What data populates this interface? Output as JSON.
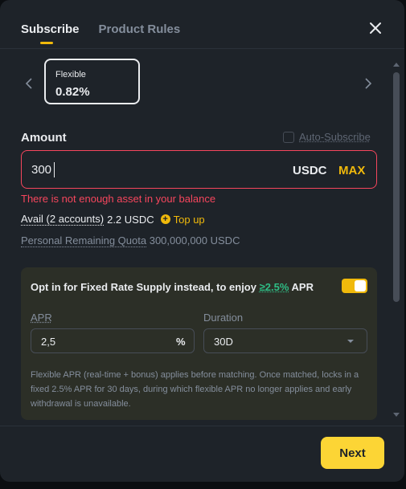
{
  "tabs": [
    {
      "label": "Subscribe",
      "active": true
    },
    {
      "label": "Product Rules",
      "active": false
    }
  ],
  "icons": {
    "close": "close-icon",
    "prev": "chevron-left-icon",
    "next": "chevron-right-icon",
    "topup": "plus-circle-icon",
    "dropdown": "chevron-down-icon"
  },
  "product": {
    "name": "Flexible",
    "rate": "0.82%"
  },
  "amount": {
    "label": "Amount",
    "auto_subscribe_label": "Auto-Subscribe",
    "auto_subscribe_checked": false,
    "value": "300",
    "unit": "USDC",
    "max_label": "MAX",
    "error": "There is not enough asset in your balance"
  },
  "avail": {
    "accounts_label": "Avail (2 accounts)",
    "value": "2.2 USDC",
    "topup_label": "Top up"
  },
  "quota": {
    "label": "Personal Remaining Quota",
    "value": "300,000,000 USDC"
  },
  "fixed": {
    "opt_prefix": "Opt in for Fixed Rate Supply instead, to enjoy",
    "opt_rate": "≥2.5%",
    "opt_suffix": "APR",
    "toggle_on": true,
    "apr_label": "APR",
    "apr_value": "2,5",
    "apr_unit": "%",
    "duration_label": "Duration",
    "duration_value": "30D",
    "note": "Flexible APR (real-time + bonus) applies before matching. Once matched, locks in a fixed 2.5% APR for 30 days, during which flexible APR no longer applies and early withdrawal is unavailable."
  },
  "footer": {
    "next_label": "Next"
  },
  "colors": {
    "accent": "#F0B90B",
    "error": "#F6465D",
    "positive": "#2EBD85",
    "panel": "#1E2329"
  }
}
